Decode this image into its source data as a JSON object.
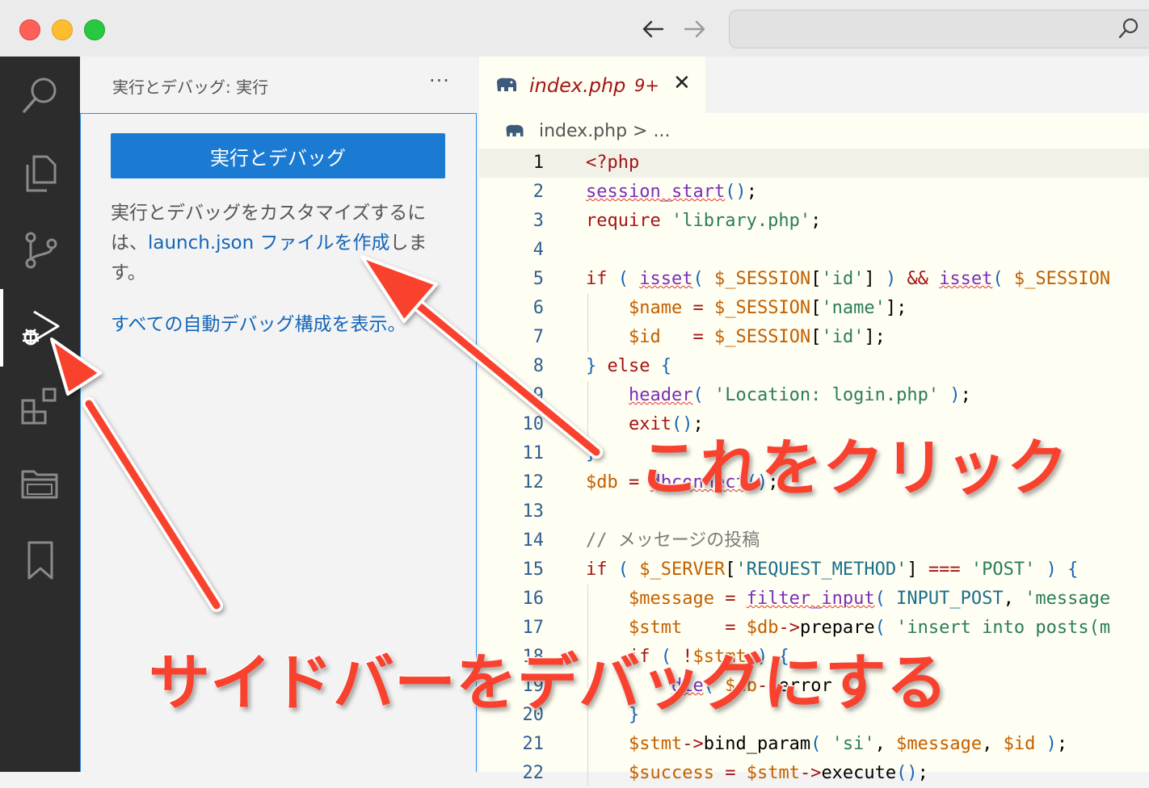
{
  "window": {
    "back_icon": "arrow-left-icon",
    "forward_icon": "arrow-right-icon",
    "search_icon": "magnifier-icon"
  },
  "activity_bar": {
    "items": [
      {
        "name": "search",
        "icon": "search-icon"
      },
      {
        "name": "explorer",
        "icon": "files-icon"
      },
      {
        "name": "source-control",
        "icon": "source-control-icon"
      },
      {
        "name": "run-and-debug",
        "icon": "run-debug-icon",
        "active": true
      },
      {
        "name": "extensions",
        "icon": "extensions-icon"
      },
      {
        "name": "folder",
        "icon": "folder-icon"
      },
      {
        "name": "bookmarks",
        "icon": "bookmark-icon"
      }
    ]
  },
  "sidebar": {
    "title": "実行とデバッグ: 実行",
    "more": "···",
    "run_button": "実行とデバッグ",
    "text_part1": "実行とデバッグをカスタマイズするには、",
    "text_link": "launch.json ファイルを作成",
    "text_part2": "します。",
    "show_all_link": "すべての自動デバッグ構成を表示。"
  },
  "editor": {
    "tab": {
      "name": "index.php",
      "badge": "9+",
      "close": "✕"
    },
    "breadcrumb": "index.php > ...",
    "current_line": 1,
    "lines": [
      {
        "n": "1"
      },
      {
        "n": "2"
      },
      {
        "n": "3"
      },
      {
        "n": "4"
      },
      {
        "n": "5"
      },
      {
        "n": "6"
      },
      {
        "n": "7"
      },
      {
        "n": "8"
      },
      {
        "n": "9"
      },
      {
        "n": "10"
      },
      {
        "n": "11"
      },
      {
        "n": "12"
      },
      {
        "n": "13"
      },
      {
        "n": "14"
      },
      {
        "n": "15"
      },
      {
        "n": "16"
      },
      {
        "n": "17"
      },
      {
        "n": "18"
      },
      {
        "n": "19"
      },
      {
        "n": "20"
      },
      {
        "n": "21"
      },
      {
        "n": "22"
      }
    ]
  },
  "annotations": {
    "click_this": "これをクリック",
    "sidebar_to_debug": "サイドバーをデバッグにする"
  },
  "colors": {
    "accent": "#1b7bd3",
    "annotation": "#f9422d",
    "activity_bg": "#2c2c2c"
  }
}
